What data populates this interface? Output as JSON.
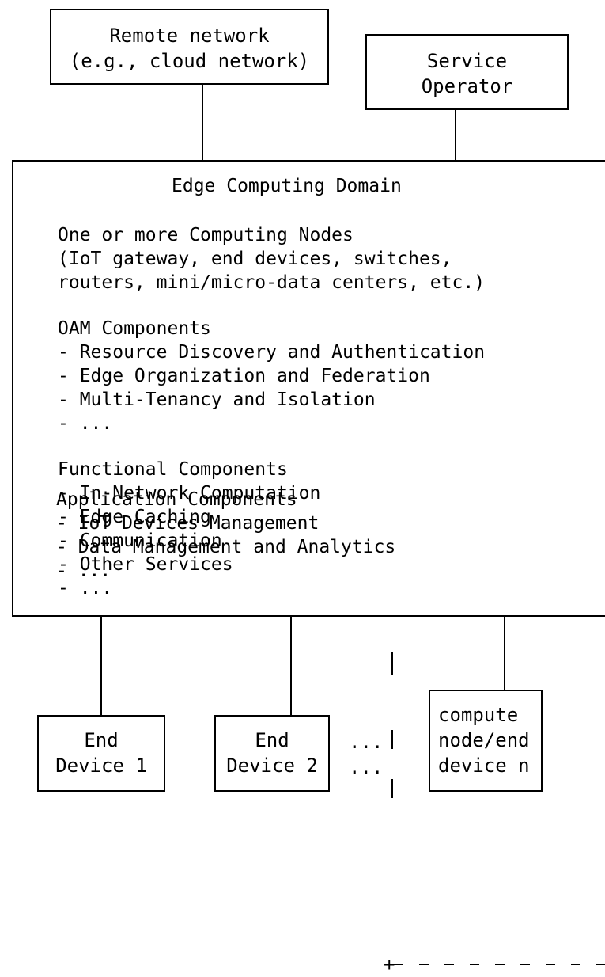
{
  "remote_network": {
    "line1": "Remote network",
    "line2": "(e.g., cloud network)"
  },
  "service_operator": {
    "line1": "Service",
    "line2": "Operator"
  },
  "edge_domain": {
    "title": "Edge Computing Domain",
    "nodes_lines": [
      "One or more Computing Nodes",
      "(IoT gateway, end devices, switches,",
      "routers, mini/micro-data centers, etc.)"
    ],
    "oam_heading": "OAM Components",
    "oam_items": [
      "- Resource Discovery and Authentication",
      "- Edge Organization and Federation",
      "- Multi-Tenancy and Isolation",
      "- ..."
    ],
    "functional_heading": "Functional Components",
    "functional_items": [
      "- In-Network Computation",
      "- Edge Caching",
      "- Communication",
      "- Other Services",
      "- ..."
    ],
    "application_heading": "Application Components",
    "application_items": [
      "- IoT Devices Management",
      "- Data Management and Analytics",
      "- ..."
    ]
  },
  "end_device_1": {
    "line1": "End",
    "line2": "Device 1"
  },
  "end_device_2": {
    "line1": "End",
    "line2": "Device 2"
  },
  "ellipsis_1": "...",
  "ellipsis_2": "...",
  "compute_node": {
    "line1": "compute",
    "line2": "node/end",
    "line3": "device n"
  },
  "dashed_corner": "+"
}
